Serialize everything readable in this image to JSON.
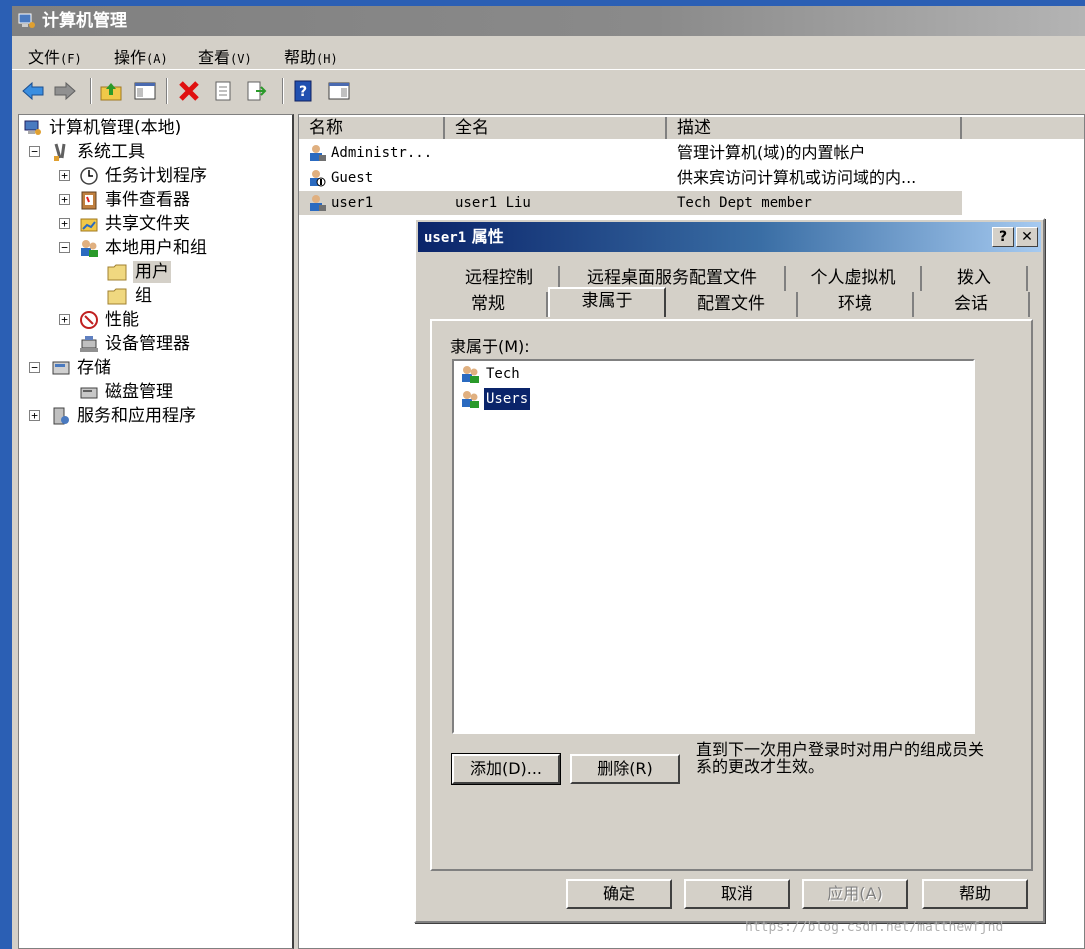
{
  "window": {
    "title": "计算机管理"
  },
  "menu": [
    {
      "label": "文件",
      "key": "(F)"
    },
    {
      "label": "操作",
      "key": "(A)"
    },
    {
      "label": "查看",
      "key": "(V)"
    },
    {
      "label": "帮助",
      "key": "(H)"
    }
  ],
  "toolbar_icons": [
    "back-arrow-icon",
    "forward-arrow-icon",
    "up-folder-icon",
    "show-hide-tree-icon",
    "delete-icon",
    "properties-icon",
    "export-list-icon",
    "help-icon",
    "show-hide-action-pane-icon"
  ],
  "tree": {
    "root": "计算机管理(本地)",
    "system_tools": "系统工具",
    "task_scheduler": "任务计划程序",
    "event_viewer": "事件查看器",
    "shared_folders": "共享文件夹",
    "local_users_groups": "本地用户和组",
    "users": "用户",
    "groups": "组",
    "performance": "性能",
    "device_manager": "设备管理器",
    "storage": "存储",
    "disk_management": "磁盘管理",
    "services_apps": "服务和应用程序"
  },
  "list": {
    "columns": [
      "名称",
      "全名",
      "描述"
    ],
    "rows": [
      {
        "name": "Administr...",
        "full_name": "",
        "description": "管理计算机(域)的内置帐户"
      },
      {
        "name": "Guest",
        "full_name": "",
        "description": "供来宾访问计算机或访问域的内..."
      },
      {
        "name": "user1",
        "full_name": "user1 Liu",
        "description": "Tech Dept member"
      }
    ]
  },
  "dialog": {
    "title_user": "user1",
    "title_suffix": "属性",
    "help_btn": "?",
    "close_btn": "✕",
    "tabs_row1": [
      "远程控制",
      "远程桌面服务配置文件",
      "个人虚拟机",
      "拨入"
    ],
    "tabs_row2": [
      "常规",
      "隶属于",
      "配置文件",
      "环境",
      "会话"
    ],
    "active_tab": "隶属于",
    "members_label": "隶属于(M):",
    "members": [
      "Tech",
      "Users"
    ],
    "selected_member": "Users",
    "add_btn": "添加(D)...",
    "remove_btn": "删除(R)",
    "note": "直到下一次用户登录时对用户的组成员关系的更改才生效。",
    "ok_btn": "确定",
    "cancel_btn": "取消",
    "apply_btn": "应用(A)",
    "help_button": "帮助"
  },
  "watermark": "https://blog.csdn.net/matthewfjnd"
}
